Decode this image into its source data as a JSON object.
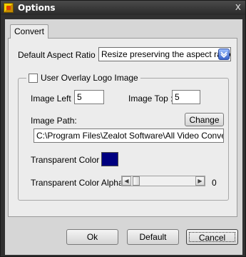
{
  "window": {
    "title": "Options",
    "close_glyph": "x"
  },
  "tabs": [
    {
      "label": "Convert",
      "selected": true
    }
  ],
  "aspect": {
    "label": "Default Aspect Ratio :",
    "value": "Resize preserving the aspect ratio",
    "button_icon": "dropdown-arrow-icon"
  },
  "overlay": {
    "checkbox_label": "User Overlay Logo Image",
    "checked": false,
    "left_label": "Image Left :",
    "left_value": "5",
    "top_label": "Image Top :",
    "top_value": "5",
    "path_label": "Image Path:",
    "change_label": "Change",
    "path_value": "C:\\Program Files\\Zealot Software\\All Video Converter Free",
    "color_label": "Transparent Color :",
    "color_value": "#000080",
    "alpha_label": "Transparent Color Alpha :",
    "alpha_value": "0",
    "alpha_fraction": 0.0
  },
  "buttons": {
    "ok": "Ok",
    "default": "Default",
    "cancel": "Cancel"
  },
  "colors": {
    "titlebar": "#2a2a2a",
    "panel": "#ececec",
    "swatch": "#000080"
  }
}
